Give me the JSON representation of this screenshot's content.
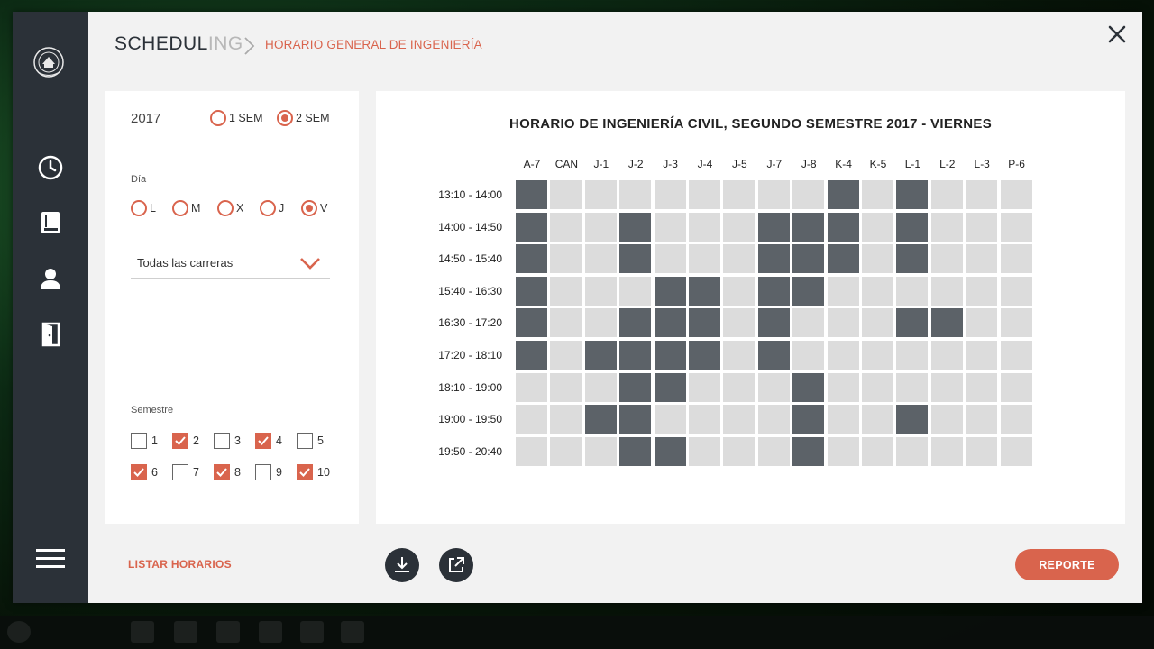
{
  "app": {
    "title_main": "SCHEDUL",
    "title_dim": "ING",
    "breadcrumb": "HORARIO GENERAL DE INGENIERÍA"
  },
  "filters": {
    "year": "2017",
    "semester_radios": [
      {
        "label": "1 SEM",
        "selected": false
      },
      {
        "label": "2 SEM",
        "selected": true
      }
    ],
    "day_label": "Día",
    "days": [
      {
        "label": "L",
        "selected": false
      },
      {
        "label": "M",
        "selected": false
      },
      {
        "label": "X",
        "selected": false
      },
      {
        "label": "J",
        "selected": false
      },
      {
        "label": "V",
        "selected": true
      }
    ],
    "career_dropdown": "Todas las carreras",
    "semester_label": "Semestre",
    "semesters": [
      {
        "label": "1",
        "checked": false
      },
      {
        "label": "2",
        "checked": true
      },
      {
        "label": "3",
        "checked": false
      },
      {
        "label": "4",
        "checked": true
      },
      {
        "label": "5",
        "checked": false
      },
      {
        "label": "6",
        "checked": true
      },
      {
        "label": "7",
        "checked": false
      },
      {
        "label": "8",
        "checked": true
      },
      {
        "label": "9",
        "checked": false
      },
      {
        "label": "10",
        "checked": true
      }
    ]
  },
  "schedule": {
    "title": "HORARIO DE INGENIERÍA CIVIL, SEGUNDO SEMESTRE 2017 - VIERNES",
    "rooms": [
      "A-7",
      "CAN",
      "J-1",
      "J-2",
      "J-3",
      "J-4",
      "J-5",
      "J-7",
      "J-8",
      "K-4",
      "K-5",
      "L-1",
      "L-2",
      "L-3",
      "P-6"
    ],
    "slots": [
      "13:10 - 14:00",
      "14:00 - 14:50",
      "14:50 - 15:40",
      "15:40 - 16:30",
      "16:30 - 17:20",
      "17:20 - 18:10",
      "18:10 - 19:00",
      "19:00 - 19:50",
      "19:50 - 20:40"
    ],
    "occupancy": [
      [
        1,
        0,
        0,
        0,
        0,
        0,
        0,
        0,
        0,
        1,
        0,
        1,
        0,
        0,
        0
      ],
      [
        1,
        0,
        0,
        1,
        0,
        0,
        0,
        1,
        1,
        1,
        0,
        1,
        0,
        0,
        0
      ],
      [
        1,
        0,
        0,
        1,
        0,
        0,
        0,
        1,
        1,
        1,
        0,
        1,
        0,
        0,
        0
      ],
      [
        1,
        0,
        0,
        0,
        1,
        1,
        0,
        1,
        1,
        0,
        0,
        0,
        0,
        0,
        0
      ],
      [
        1,
        0,
        0,
        1,
        1,
        1,
        0,
        1,
        0,
        0,
        0,
        1,
        1,
        0,
        0
      ],
      [
        1,
        0,
        1,
        1,
        1,
        1,
        0,
        1,
        0,
        0,
        0,
        0,
        0,
        0,
        0
      ],
      [
        0,
        0,
        0,
        1,
        1,
        0,
        0,
        0,
        1,
        0,
        0,
        0,
        0,
        0,
        0
      ],
      [
        0,
        0,
        1,
        1,
        0,
        0,
        0,
        0,
        1,
        0,
        0,
        1,
        0,
        0,
        0
      ],
      [
        0,
        0,
        0,
        1,
        1,
        0,
        0,
        0,
        1,
        0,
        0,
        0,
        0,
        0,
        0
      ]
    ]
  },
  "footer": {
    "list_link": "LISTAR HORARIOS",
    "report_button": "REPORTE"
  },
  "colors": {
    "accent": "#d9644d",
    "sidebar": "#2b3138",
    "busy": "#5c6268",
    "free": "#dcdcdc"
  }
}
